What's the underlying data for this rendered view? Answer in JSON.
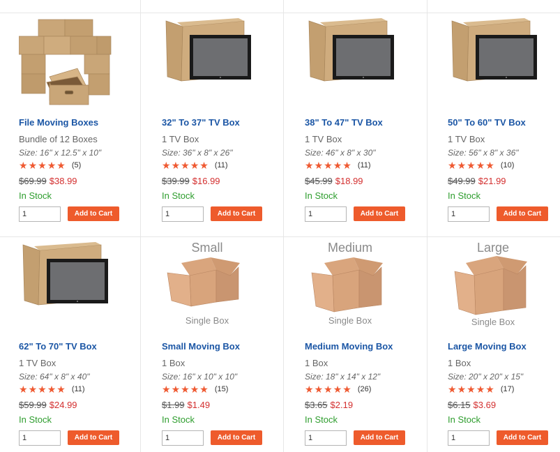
{
  "products": [
    {
      "title": "File Moving Boxes",
      "qty": "Bundle of 12 Boxes",
      "size": "Size: 16\" x 12.5\" x 10\"",
      "reviews": "(5)",
      "old_price": "$69.99",
      "new_price": "$38.99",
      "stock": "In Stock",
      "qty_value": "1",
      "cart_label": "Add to Cart",
      "image": "stack-of-file-boxes",
      "rating": 5
    },
    {
      "title": "32\" To 37\" TV Box",
      "qty": "1 TV Box",
      "size": "Size: 36\" x 8\" x 26\"",
      "reviews": "(11)",
      "old_price": "$39.99",
      "new_price": "$16.99",
      "stock": "In Stock",
      "qty_value": "1",
      "cart_label": "Add to Cart",
      "image": "tv-box",
      "rating": 5
    },
    {
      "title": "38\" To 47\" TV Box",
      "qty": "1 TV Box",
      "size": "Size: 46\" x 8\" x 30\"",
      "reviews": "(11)",
      "old_price": "$45.99",
      "new_price": "$18.99",
      "stock": "In Stock",
      "qty_value": "1",
      "cart_label": "Add to Cart",
      "image": "tv-box",
      "rating": 5
    },
    {
      "title": "50\" To 60\" TV Box",
      "qty": "1 TV Box",
      "size": "Size: 56\" x 8\" x 36\"",
      "reviews": "(10)",
      "old_price": "$49.99",
      "new_price": "$21.99",
      "stock": "In Stock",
      "qty_value": "1",
      "cart_label": "Add to Cart",
      "image": "tv-box",
      "rating": 5
    },
    {
      "title": "62\" To 70\" TV Box",
      "qty": "1 TV Box",
      "size": "Size: 64\" x 8\" x 40\"",
      "reviews": "(11)",
      "old_price": "$59.99",
      "new_price": "$24.99",
      "stock": "In Stock",
      "qty_value": "1",
      "cart_label": "Add to Cart",
      "image": "tv-box",
      "rating": 5
    },
    {
      "title": "Small Moving Box",
      "qty": "1 Box",
      "size": "Size: 16\" x 10\" x 10\"",
      "reviews": "(15)",
      "old_price": "$1.99",
      "new_price": "$1.49",
      "stock": "In Stock",
      "qty_value": "1",
      "cart_label": "Add to Cart",
      "image": "open-box",
      "image_top_label": "Small",
      "image_bottom_label": "Single Box",
      "rating": 5
    },
    {
      "title": "Medium Moving Box",
      "qty": "1 Box",
      "size": "Size: 18\" x 14\" x 12\"",
      "reviews": "(26)",
      "old_price": "$3.65",
      "new_price": "$2.19",
      "stock": "In Stock",
      "qty_value": "1",
      "cart_label": "Add to Cart",
      "image": "open-box",
      "image_top_label": "Medium",
      "image_bottom_label": "Single Box",
      "rating": 5
    },
    {
      "title": "Large Moving Box",
      "qty": "1 Box",
      "size": "Size: 20\" x 20\" x 15\"",
      "reviews": "(17)",
      "old_price": "$6.15",
      "new_price": "$3.69",
      "stock": "In Stock",
      "qty_value": "1",
      "cart_label": "Add to Cart",
      "image": "open-box",
      "image_top_label": "Large",
      "image_bottom_label": "Single Box",
      "rating": 5
    }
  ],
  "colors": {
    "link": "#1b56a5",
    "price_new": "#d32f2f",
    "in_stock": "#2e9d2e",
    "button": "#ee5b2c",
    "star": "#ef5a32"
  }
}
